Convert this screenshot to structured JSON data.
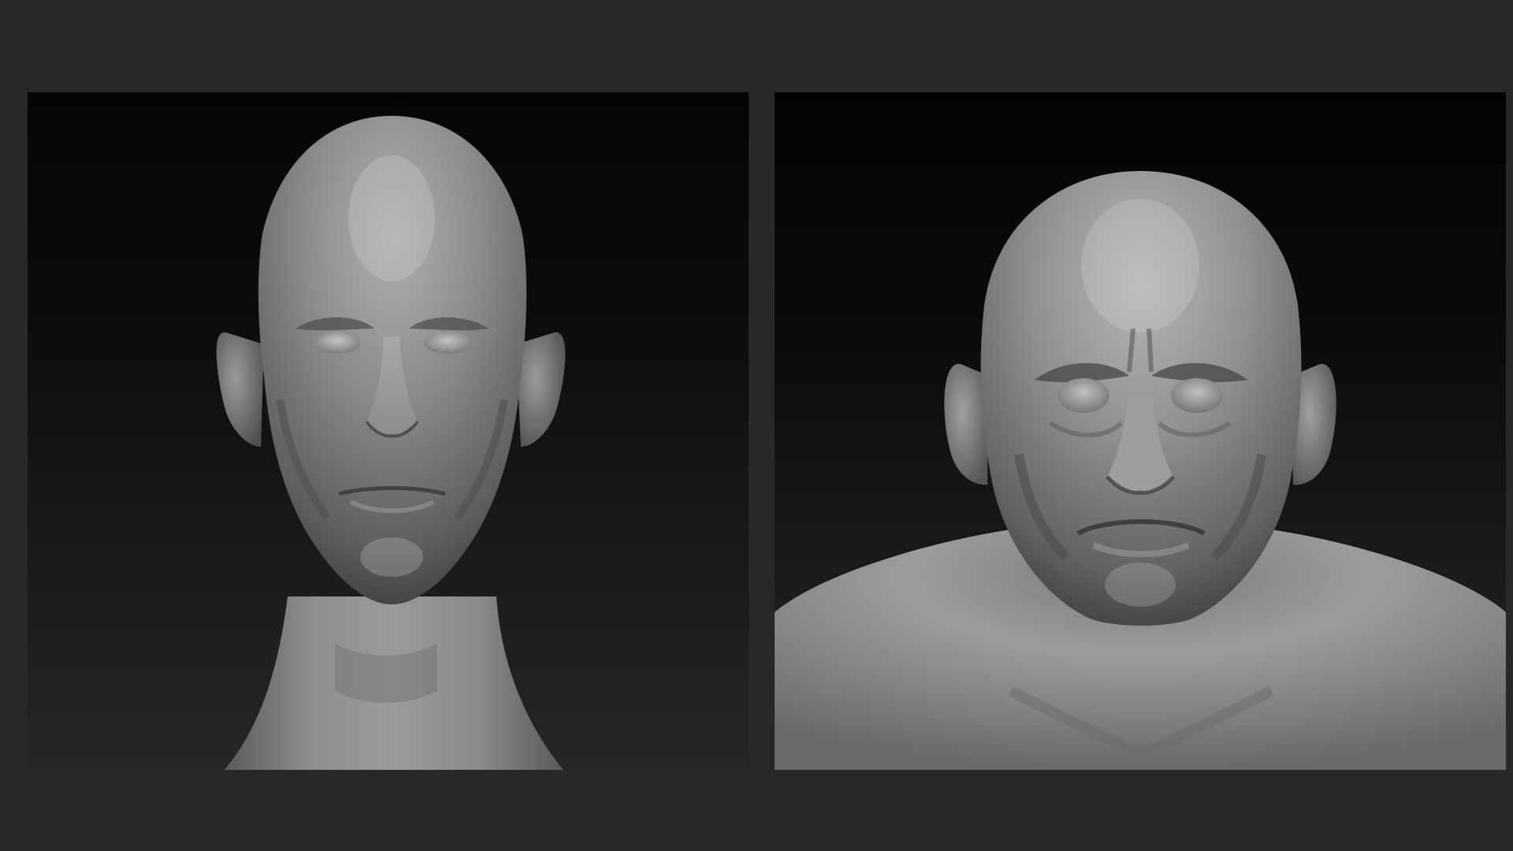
{
  "image": {
    "background_color": "#282828",
    "panels": [
      {
        "subject": "thin-head-sculpt",
        "style": "grey-clay-render"
      },
      {
        "subject": "heavy-head-sculpt",
        "style": "grey-clay-render"
      }
    ]
  }
}
